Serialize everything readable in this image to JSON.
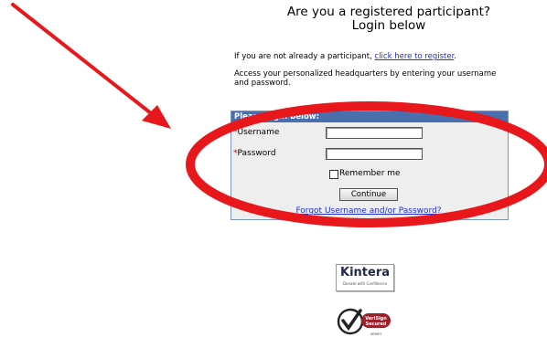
{
  "page": {
    "heading_line1": "Are you a registered participant?",
    "heading_line2": "Login below",
    "register_prefix": "If you are not already a participant, ",
    "register_link": "click here to register",
    "register_suffix": ".",
    "access_text": "Access your personalized headquarters by entering your username and password."
  },
  "login": {
    "header": "Please login below:",
    "required_marker": "*",
    "username_label": "Username",
    "password_label": "Password",
    "username_value": "",
    "password_value": "",
    "remember_label": "Remember me",
    "remember_checked": false,
    "continue_label": "Continue",
    "forgot_link": "Forgot Username and/or Password?"
  },
  "badges": {
    "kintera_name": "Kintera",
    "kintera_tagline": "Donate with Confidence",
    "verisign_line1": "VeriSign",
    "verisign_line2": "Secured",
    "verisign_line3": "VERIFY"
  },
  "annotation": {
    "arrow_color": "#e8171b",
    "circle_color": "#e8171b"
  },
  "colors": {
    "header_bg": "#4a6fae",
    "box_bg": "#eeeeee",
    "link": "#1f2fd0",
    "required": "#c00000"
  }
}
